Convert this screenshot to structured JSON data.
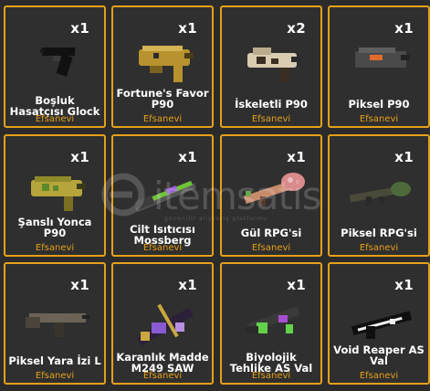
{
  "items": [
    {
      "qty": "x1",
      "name": "Boşluk Hasatçısı Glock",
      "rarity": "Efsanevi",
      "icon": "glock-pistol-icon",
      "accent": "#111111"
    },
    {
      "qty": "x1",
      "name": "Fortune's Favor P90",
      "rarity": "Efsanevi",
      "icon": "gold-p90-icon",
      "accent": "#b8922e"
    },
    {
      "qty": "x2",
      "name": "İskeletli P90",
      "rarity": "Efsanevi",
      "icon": "skeleton-p90-icon",
      "accent": "#d9ccb0"
    },
    {
      "qty": "x1",
      "name": "Piksel P90",
      "rarity": "Efsanevi",
      "icon": "pixel-p90-icon",
      "accent": "#4a4a4a"
    },
    {
      "qty": "x1",
      "name": "Şanslı Yonca P90",
      "rarity": "Efsanevi",
      "icon": "clover-p90-icon",
      "accent": "#b5a53a"
    },
    {
      "qty": "x1",
      "name": "Cilt Isıtıcısı Mossberg",
      "rarity": "Efsanevi",
      "icon": "mossberg-shotgun-icon",
      "accent": "#6fc33a"
    },
    {
      "qty": "x1",
      "name": "Gül RPG'si",
      "rarity": "Efsanevi",
      "icon": "rose-rpg-icon",
      "accent": "#d98a8a"
    },
    {
      "qty": "x1",
      "name": "Piksel RPG'si",
      "rarity": "Efsanevi",
      "icon": "pixel-rpg-icon",
      "accent": "#4f6a3a"
    },
    {
      "qty": "x1",
      "name": "Piksel Yara İzi L",
      "rarity": "Efsanevi",
      "icon": "pixel-scar-rifle-icon",
      "accent": "#6b6356"
    },
    {
      "qty": "x1",
      "name": "Karanlık Madde M249 SAW",
      "rarity": "Efsanevi",
      "icon": "dark-matter-m249-icon",
      "accent": "#c9a640"
    },
    {
      "qty": "x1",
      "name": "Biyolojik Tehlike AS Val",
      "rarity": "Efsanevi",
      "icon": "biohazard-asval-icon",
      "accent": "#62d24a"
    },
    {
      "qty": "x1",
      "name": "Void Reaper AS Val",
      "rarity": "Efsanevi",
      "icon": "void-asval-icon",
      "accent": "#f0f0f0"
    }
  ],
  "watermark": {
    "text": "itemsatis",
    "sub": "güvenilir alışveriş platformu"
  },
  "colors": {
    "border": "#e6a019",
    "rarity": "#e6a019",
    "card_bg": "#2f2f2f",
    "page_bg": "#2b2b2b"
  }
}
